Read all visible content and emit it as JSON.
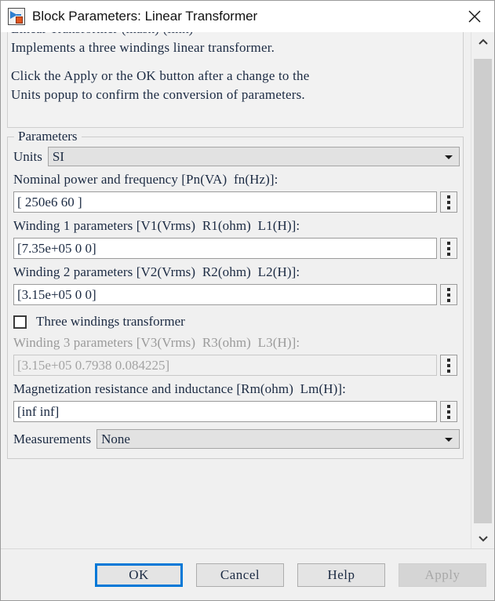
{
  "window": {
    "title": "Block Parameters: Linear Transformer",
    "icon": "simulink-block-icon",
    "close_label": "✕"
  },
  "description": {
    "line1": "Linear Transformer (mask) (link)",
    "line2": "Implements a three windings linear transformer.",
    "line3": "Click the Apply or the OK button after a change to the",
    "line4": "Units popup to confirm the conversion of parameters."
  },
  "parameters": {
    "group_title": "Parameters",
    "units": {
      "label": "Units",
      "value": "SI"
    },
    "nominal": {
      "label": "Nominal power and frequency [Pn(VA)  fn(Hz)]:",
      "value": "[ 250e6 60 ]"
    },
    "winding1": {
      "label": "Winding 1 parameters [V1(Vrms)  R1(ohm)  L1(H)]:",
      "value": "[7.35e+05 0 0]"
    },
    "winding2": {
      "label": "Winding 2 parameters [V2(Vrms)  R2(ohm)  L2(H)]:",
      "value": "[3.15e+05 0 0]"
    },
    "three_windings": {
      "label": "Three windings transformer",
      "checked": false
    },
    "winding3": {
      "label": "Winding 3 parameters [V3(Vrms)  R3(ohm)  L3(H)]:",
      "value": "[3.15e+05 0.7938 0.084225]",
      "disabled": true
    },
    "magnetization": {
      "label": "Magnetization resistance and inductance [Rm(ohm)  Lm(H)]:",
      "value": "[inf inf]"
    },
    "measurements": {
      "label": "Measurements",
      "value": "None"
    }
  },
  "scrollbar": {
    "up_icon": "chevron-up-icon",
    "down_icon": "chevron-down-icon"
  },
  "footer": {
    "ok": "OK",
    "cancel": "Cancel",
    "help": "Help",
    "apply": "Apply"
  },
  "colors": {
    "accent": "#0078d7",
    "dialog_bg": "#f0f0f0",
    "text": "#1b2a42",
    "disabled_text": "#a3a3a3"
  }
}
